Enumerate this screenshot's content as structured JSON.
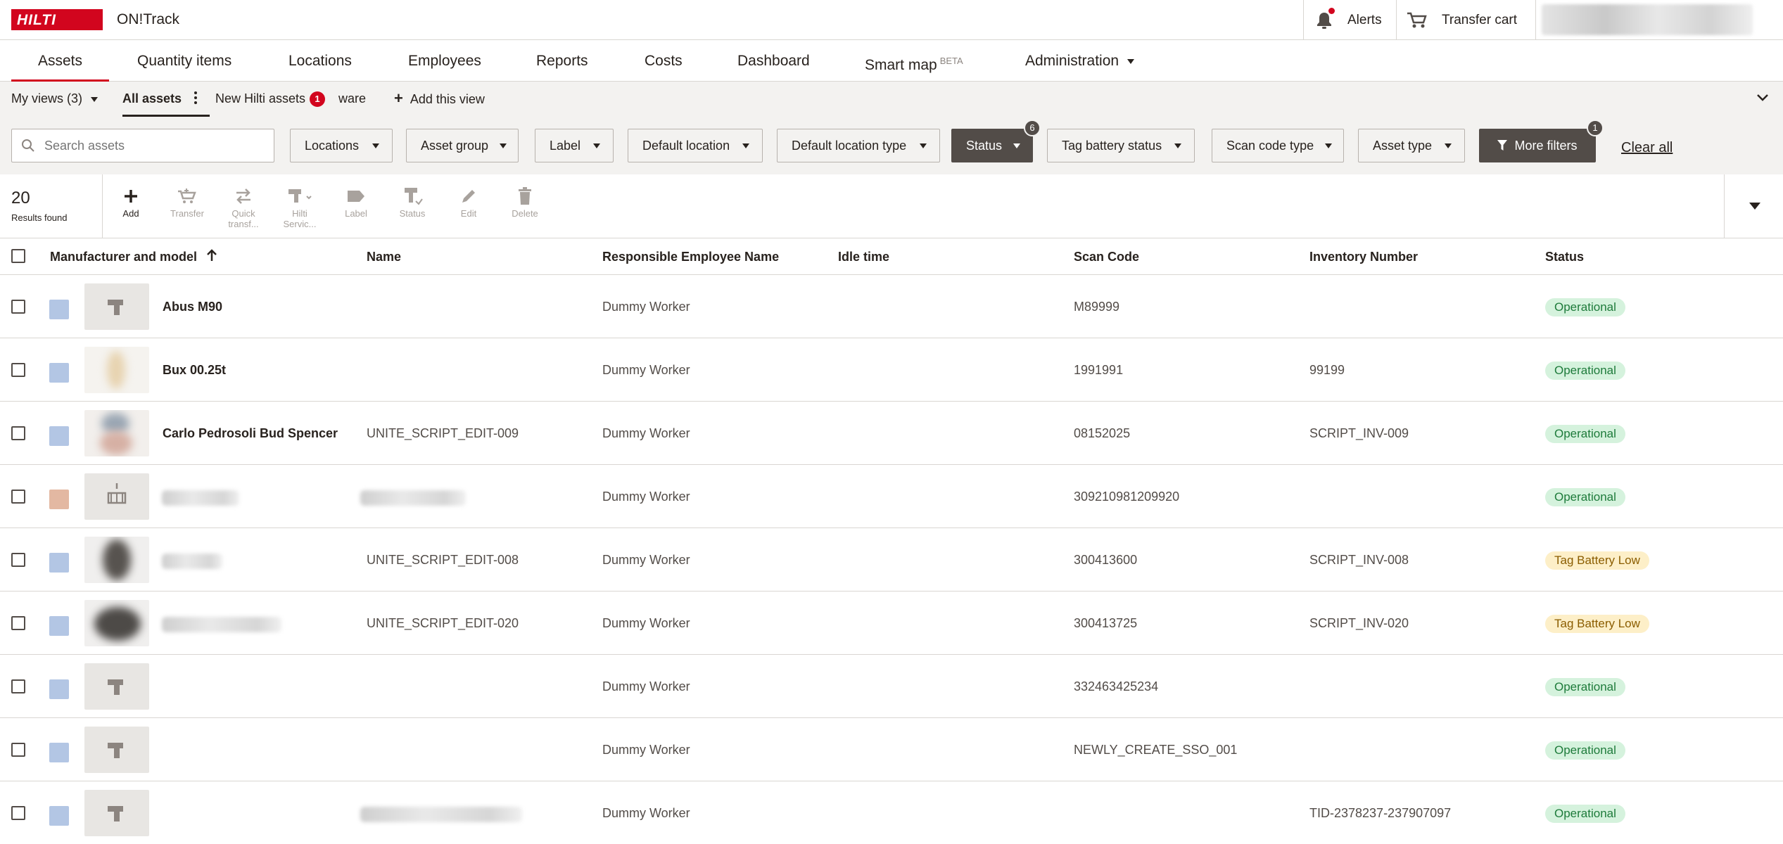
{
  "header": {
    "logo": "HILTI",
    "app_name": "ON!Track",
    "alerts_label": "Alerts",
    "cart_label": "Transfer cart"
  },
  "nav": {
    "items": [
      "Assets",
      "Quantity items",
      "Locations",
      "Employees",
      "Reports",
      "Costs",
      "Dashboard",
      "Smart map",
      "Administration"
    ],
    "smart_map_tag": "BETA"
  },
  "views": {
    "my_views": "My views (3)",
    "all_assets": "All assets",
    "new_hilti_assets": "New Hilti assets",
    "new_badge": "1",
    "ware": "ware",
    "add_view": "Add this view"
  },
  "filters": {
    "search_placeholder": "Search assets",
    "buttons": [
      "Locations",
      "Asset group",
      "Label",
      "Default location",
      "Default location type",
      "Status",
      "Tag battery status",
      "Scan code type",
      "Asset type"
    ],
    "status_count": "6",
    "more_filters": "More filters",
    "more_filters_count": "1",
    "clear_all": "Clear all"
  },
  "toolbar": {
    "results_count": "20",
    "results_label": "Results found",
    "actions": [
      "Add",
      "Transfer",
      "Quick transf...",
      "Hilti Servic...",
      "Label",
      "Status",
      "Edit",
      "Delete"
    ]
  },
  "table": {
    "columns": [
      "Manufacturer and model",
      "Name",
      "Responsible Employee Name",
      "Idle time",
      "Scan Code",
      "Inventory Number",
      "Status"
    ],
    "rows": [
      {
        "model": "Abus M90",
        "name": "",
        "employee": "Dummy Worker",
        "idle": "",
        "scan": "M89999",
        "inventory": "",
        "status": "Operational"
      },
      {
        "model": "Bux 00.25t",
        "name": "",
        "employee": "Dummy Worker",
        "idle": "",
        "scan": "1991991",
        "inventory": "99199",
        "status": "Operational"
      },
      {
        "model": "Carlo Pedrosoli Bud Spencer",
        "name": "UNITE_SCRIPT_EDIT-009",
        "employee": "Dummy Worker",
        "idle": "",
        "scan": "08152025",
        "inventory": "SCRIPT_INV-009",
        "status": "Operational"
      },
      {
        "model": "",
        "name": "",
        "employee": "Dummy Worker",
        "idle": "",
        "scan": "309210981209920",
        "inventory": "",
        "status": "Operational"
      },
      {
        "model": "",
        "name": "UNITE_SCRIPT_EDIT-008",
        "employee": "Dummy Worker",
        "idle": "",
        "scan": "300413600",
        "inventory": "SCRIPT_INV-008",
        "status": "Tag Battery Low"
      },
      {
        "model": "",
        "name": "UNITE_SCRIPT_EDIT-020",
        "employee": "Dummy Worker",
        "idle": "",
        "scan": "300413725",
        "inventory": "SCRIPT_INV-020",
        "status": "Tag Battery Low"
      },
      {
        "model": "",
        "name": "",
        "employee": "Dummy Worker",
        "idle": "",
        "scan": "332463425234",
        "inventory": "",
        "status": "Operational"
      },
      {
        "model": "",
        "name": "",
        "employee": "Dummy Worker",
        "idle": "",
        "scan": "NEWLY_CREATE_SSO_001",
        "inventory": "",
        "status": "Operational"
      },
      {
        "model": "",
        "name": "",
        "employee": "Dummy Worker",
        "idle": "",
        "scan": "",
        "inventory": "TID-2378237-237907097",
        "status": "Operational"
      }
    ]
  },
  "colors": {
    "brand_red": "#d2051e",
    "operational_bg": "#d5f2dd",
    "tag_low_bg": "#fdefc8",
    "dark_button": "#524c48"
  }
}
